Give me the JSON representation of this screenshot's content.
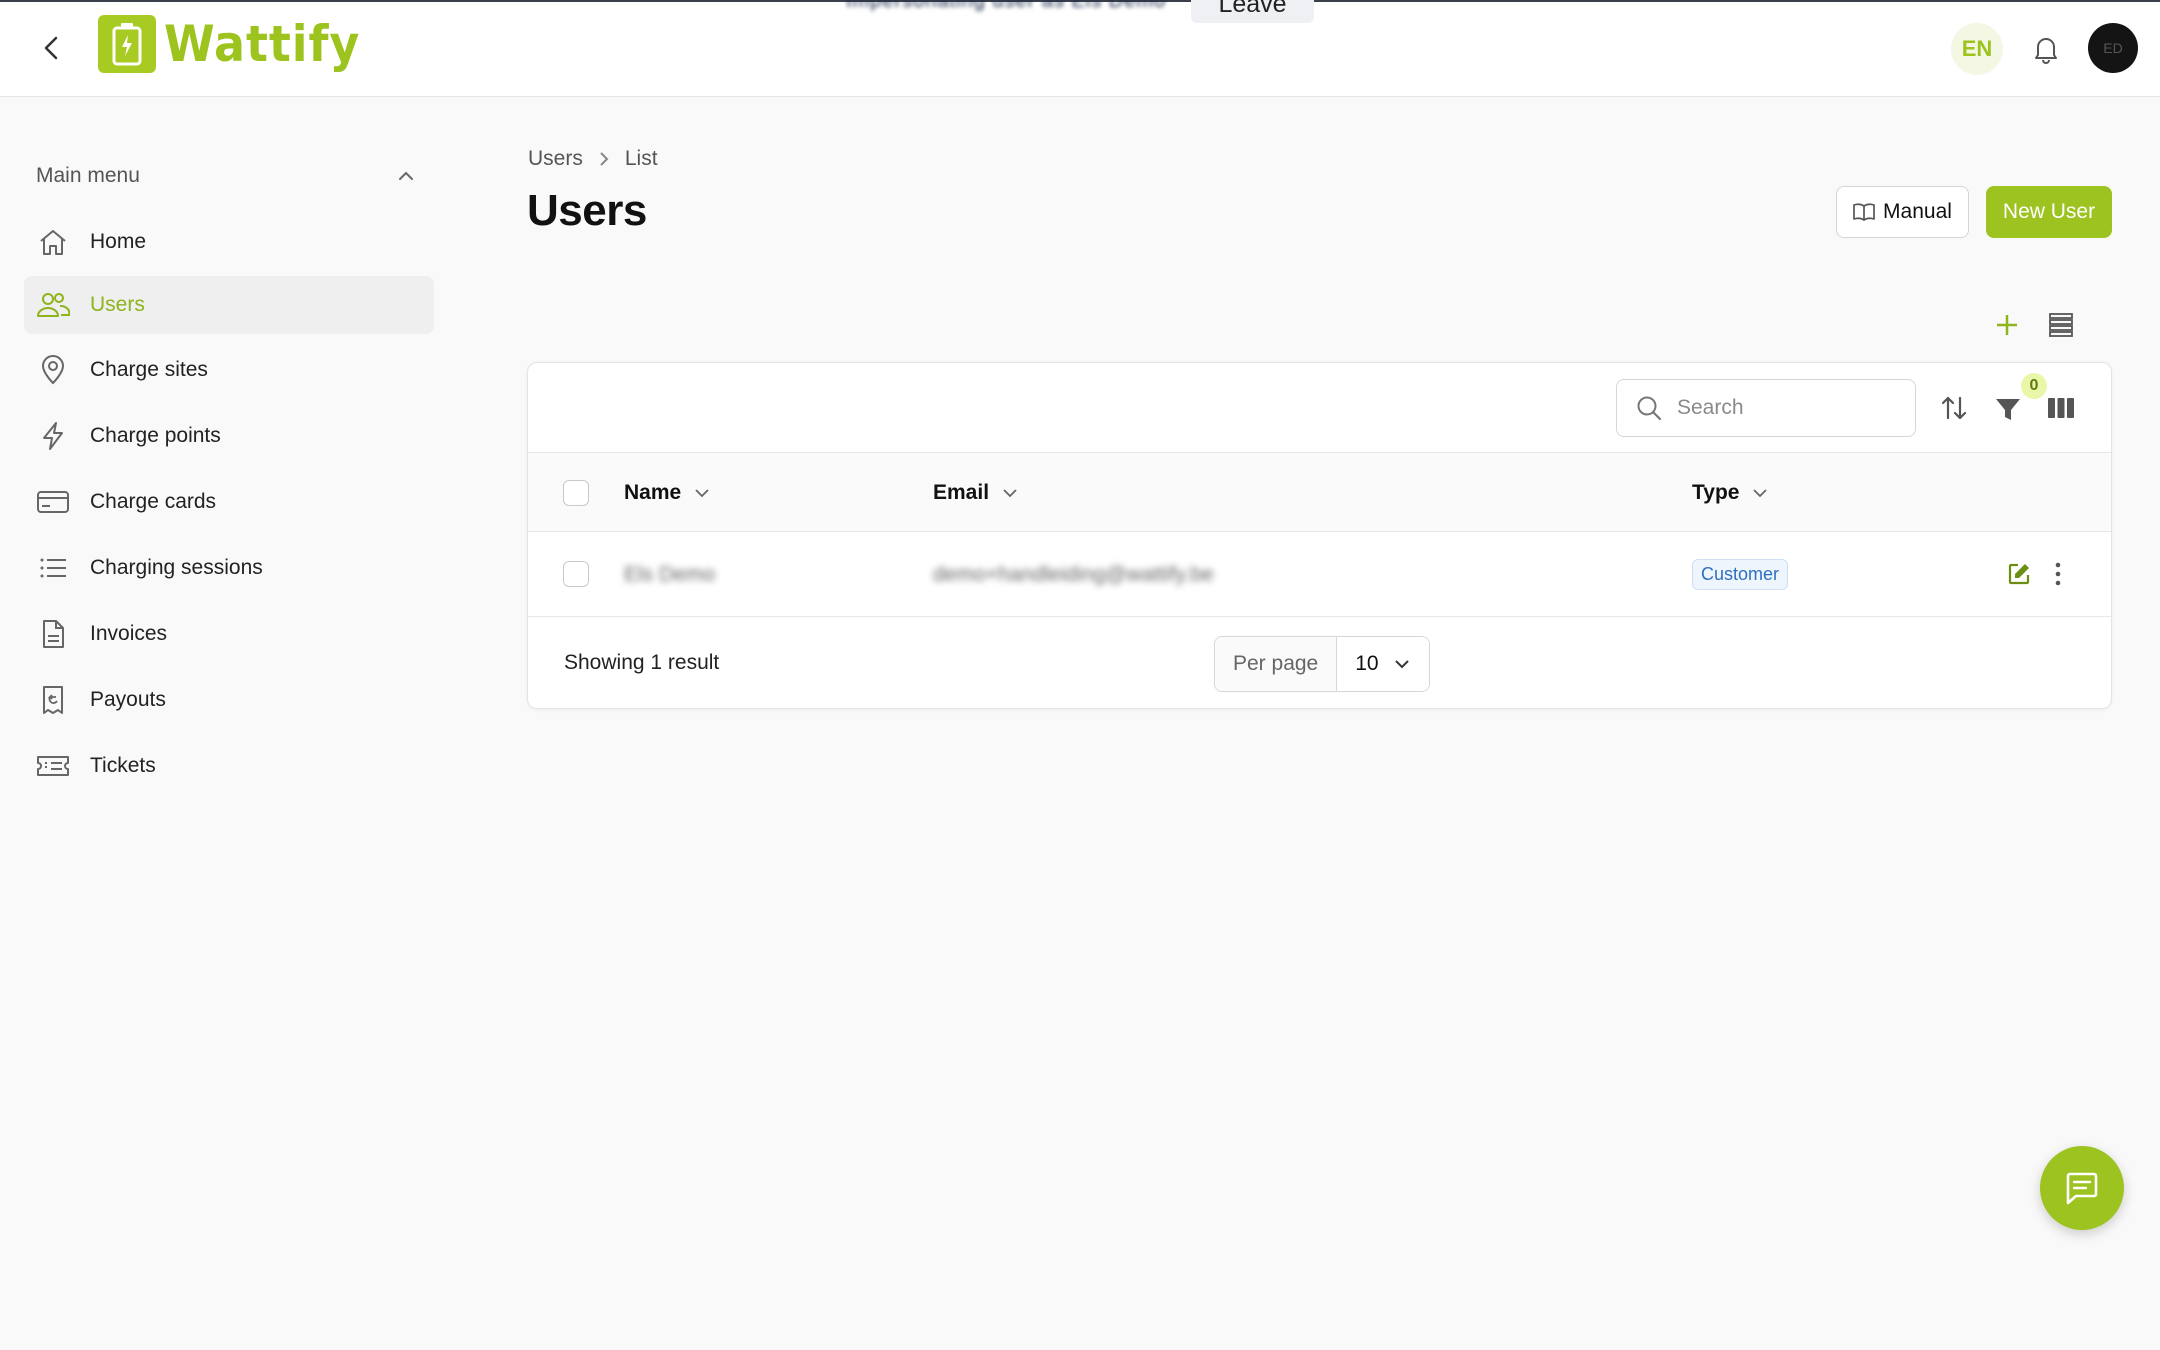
{
  "banner": {
    "text": "Impersonating user as Els Demo",
    "leave_label": "Leave"
  },
  "header": {
    "app_name": "Wattify",
    "language": "EN",
    "avatar_initials": "ED"
  },
  "sidebar": {
    "menu_title": "Main menu",
    "items": [
      {
        "label": "Home",
        "icon": "home-icon"
      },
      {
        "label": "Users",
        "icon": "users-icon",
        "active": true
      },
      {
        "label": "Charge sites",
        "icon": "map-pin-icon"
      },
      {
        "label": "Charge points",
        "icon": "lightning-icon"
      },
      {
        "label": "Charge cards",
        "icon": "credit-card-icon"
      },
      {
        "label": "Charging sessions",
        "icon": "list-icon"
      },
      {
        "label": "Invoices",
        "icon": "document-icon"
      },
      {
        "label": "Payouts",
        "icon": "receipt-icon"
      },
      {
        "label": "Tickets",
        "icon": "ticket-icon"
      }
    ]
  },
  "breadcrumb": [
    "Users",
    "List"
  ],
  "page": {
    "title": "Users",
    "manual_label": "Manual",
    "new_user_label": "New User"
  },
  "table": {
    "search_placeholder": "Search",
    "filter_count": "0",
    "columns": [
      "Name",
      "Email",
      "Type"
    ],
    "rows": [
      {
        "name": "Els Demo",
        "email": "demo+handleiding@wattify.be",
        "type": "Customer"
      }
    ],
    "result_text": "Showing 1 result",
    "per_page_label": "Per page",
    "per_page_value": "10"
  },
  "colors": {
    "brand": "#9cc31f",
    "active_text": "#8db41a",
    "badge_blue": "#2f6fc0"
  }
}
